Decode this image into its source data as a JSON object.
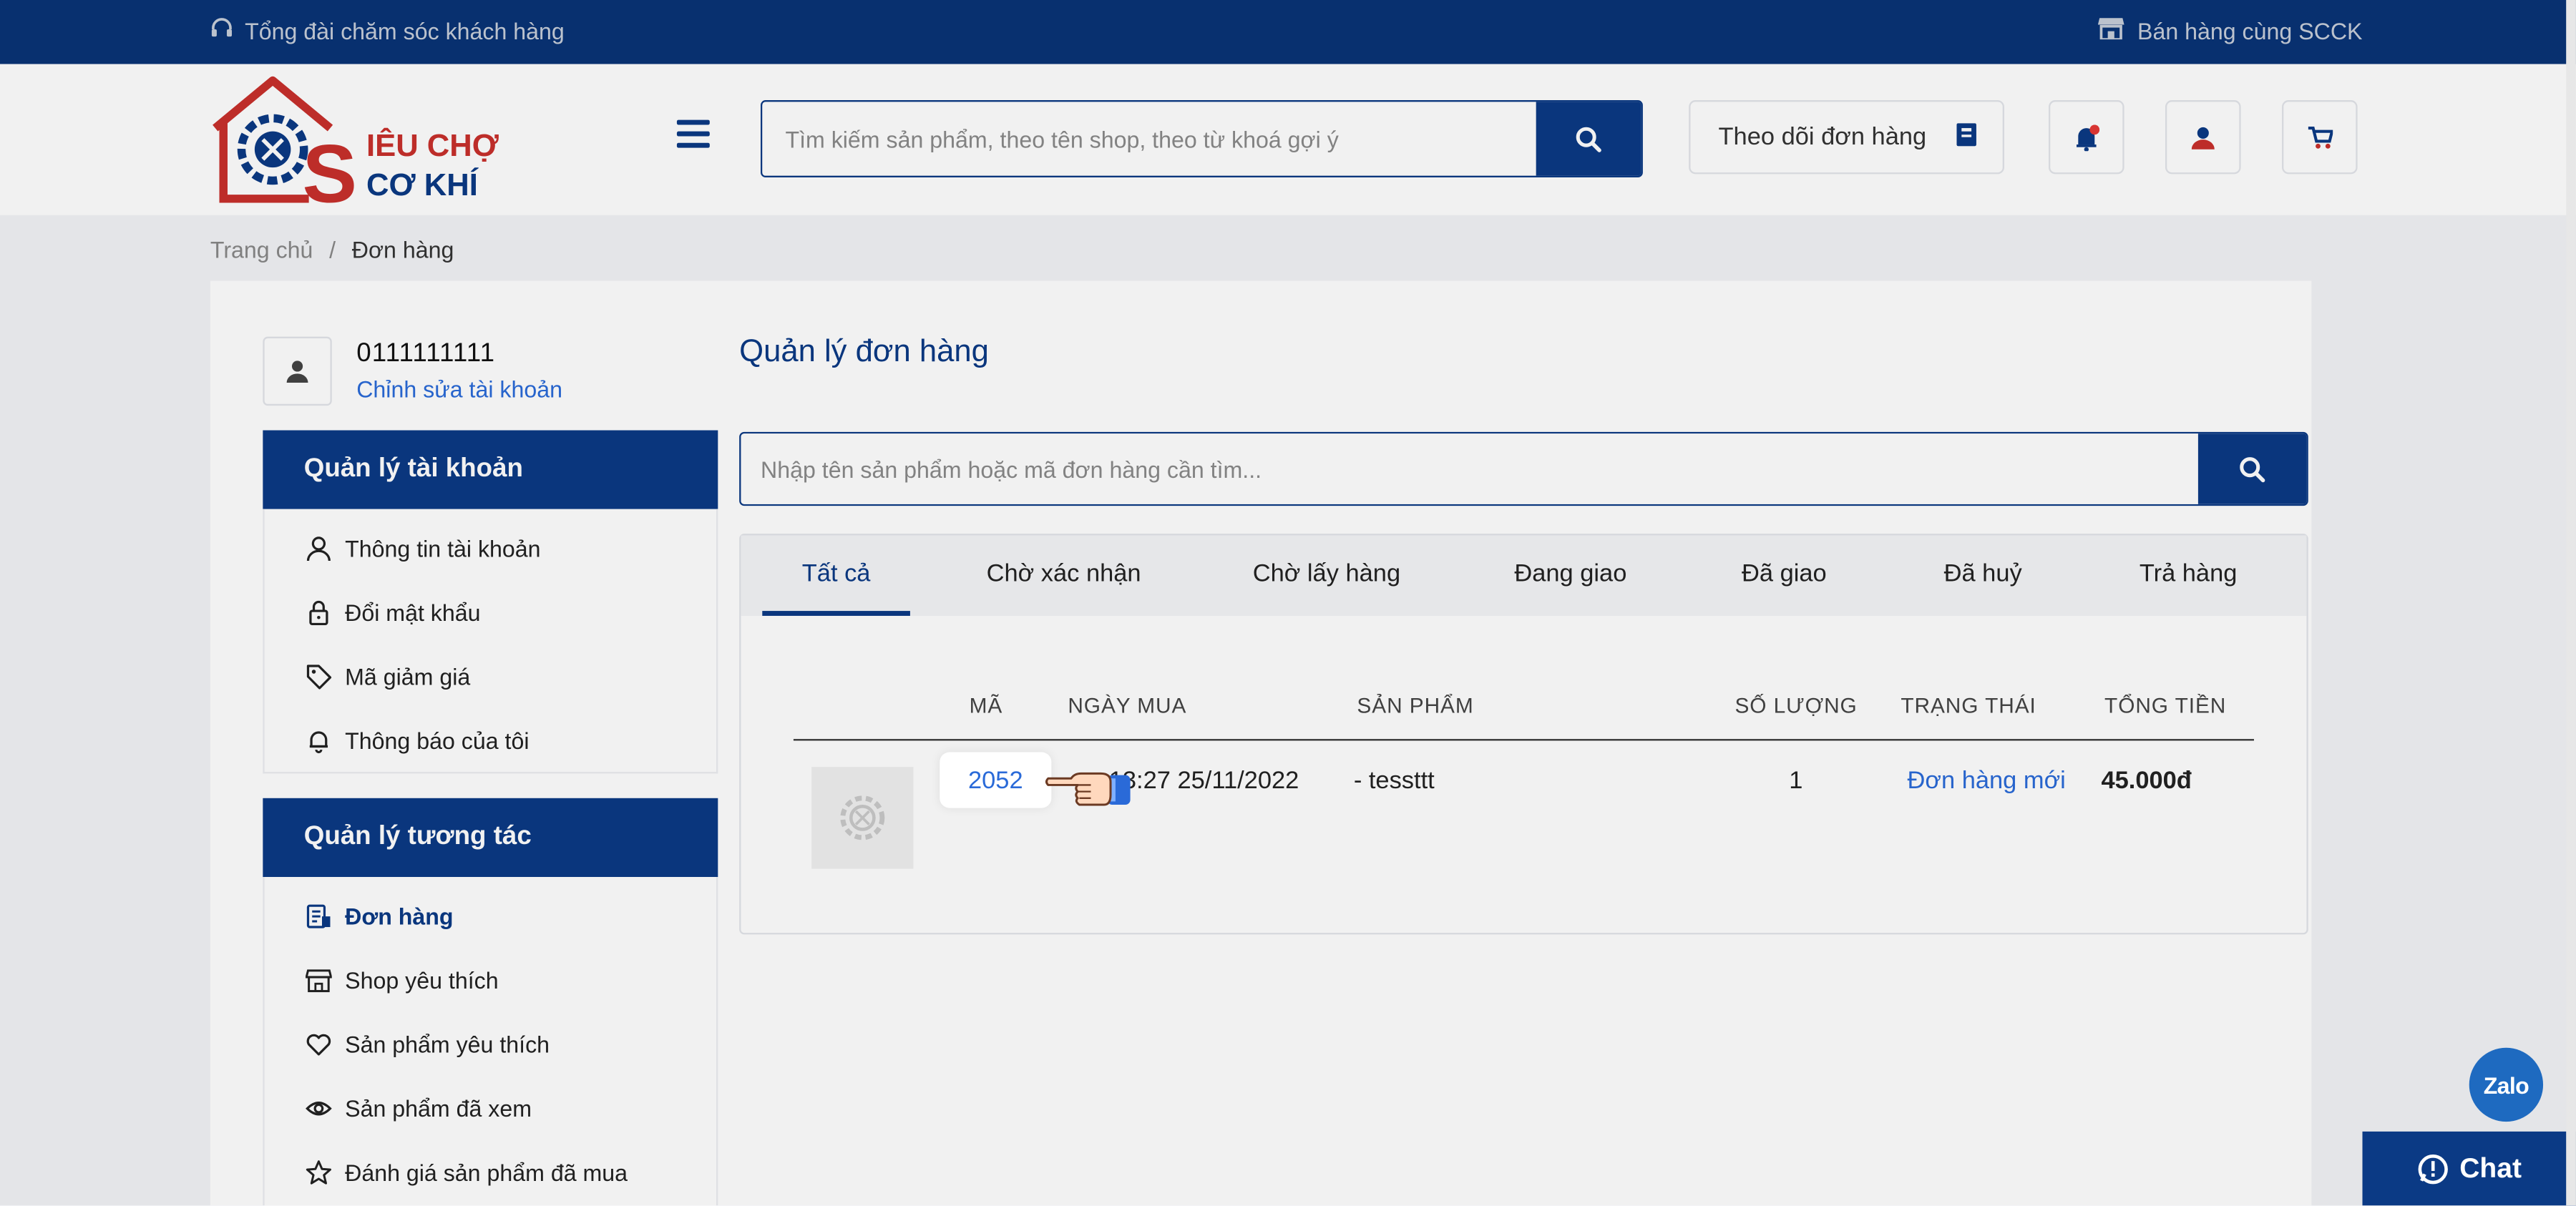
{
  "topbar": {
    "hotline_label": "Tổng đài chăm sóc khách hàng",
    "sell_label": "Bán hàng cùng SCCK"
  },
  "logo": {
    "line1": "IÊU CHỢ",
    "line2": "CƠ KHÍ",
    "initial": "S"
  },
  "header": {
    "search_placeholder": "Tìm kiếm sản phẩm, theo tên shop, theo từ khoá gợi ý",
    "track_order_label": "Theo dõi đơn hàng"
  },
  "breadcrumb": {
    "home": "Trang chủ",
    "separator": "/",
    "current": "Đơn hàng"
  },
  "user": {
    "phone": "0111111111",
    "edit_label": "Chỉnh sửa tài khoản"
  },
  "sidebar": {
    "account_section": {
      "title": "Quản lý tài khoản",
      "items": [
        {
          "label": "Thông tin tài khoản",
          "icon": "user-icon"
        },
        {
          "label": "Đổi mật khẩu",
          "icon": "lock-icon"
        },
        {
          "label": "Mã giảm giá",
          "icon": "tag-icon"
        },
        {
          "label": "Thông báo của tôi",
          "icon": "bell-icon"
        }
      ]
    },
    "interaction_section": {
      "title": "Quản lý tương tác",
      "items": [
        {
          "label": "Đơn hàng",
          "icon": "orders-icon",
          "active": true
        },
        {
          "label": "Shop yêu thích",
          "icon": "store-icon"
        },
        {
          "label": "Sản phẩm yêu thích",
          "icon": "heart-icon"
        },
        {
          "label": "Sản phẩm đã xem",
          "icon": "eye-icon"
        },
        {
          "label": "Đánh giá sản phẩm đã mua",
          "icon": "star-icon"
        }
      ]
    }
  },
  "main": {
    "title": "Quản lý đơn hàng",
    "search_placeholder": "Nhập tên sản phẩm hoặc mã đơn hàng cần tìm...",
    "tabs": [
      "Tất cả",
      "Chờ xác nhận",
      "Chờ lấy hàng",
      "Đang giao",
      "Đã giao",
      "Đã huỷ",
      "Trả hàng"
    ],
    "active_tab": "Tất cả",
    "table": {
      "headers": [
        "MÃ",
        "NGÀY MUA",
        "SẢN PHẨM",
        "SỐ LƯỢNG",
        "TRẠNG THÁI",
        "TỔNG TIỀN"
      ],
      "rows": [
        {
          "code": "2052",
          "date": "13:27 25/11/2022",
          "product": "- tessttt",
          "quantity": "1",
          "status": "Đơn hàng mới",
          "total": "45.000đ"
        }
      ]
    }
  },
  "widgets": {
    "zalo_label": "Zalo",
    "chat_label": "Chat"
  },
  "colors": {
    "brand": "#0b3a85",
    "link": "#2a6ad8",
    "logo_red": "#c8302c"
  }
}
